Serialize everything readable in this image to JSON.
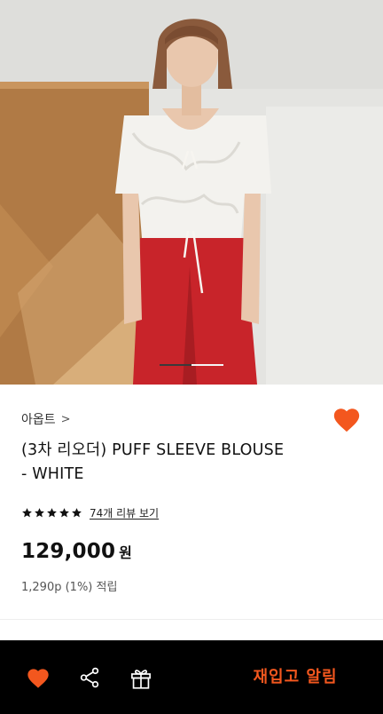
{
  "carousel": {
    "slide_count": 2,
    "active_index": 0
  },
  "product": {
    "brand": "아옵트",
    "brand_chevron": ">",
    "title_line1": "(3차 리오더) PUFF SLEEVE BLOUSE",
    "title_line2": "- WHITE",
    "rating_stars": 5,
    "review_link": "74개 리뷰 보기",
    "price": "129,000",
    "currency": "원",
    "points": "1,290p (1%) 적립",
    "wishlisted": true
  },
  "bottom_bar": {
    "restock_label": "재입고 알림"
  },
  "colors": {
    "accent": "#f3571e",
    "bar_bg": "#000000"
  },
  "icons": [
    "heart-icon",
    "share-icon",
    "gift-icon",
    "star-icon",
    "chevron-right-icon"
  ]
}
